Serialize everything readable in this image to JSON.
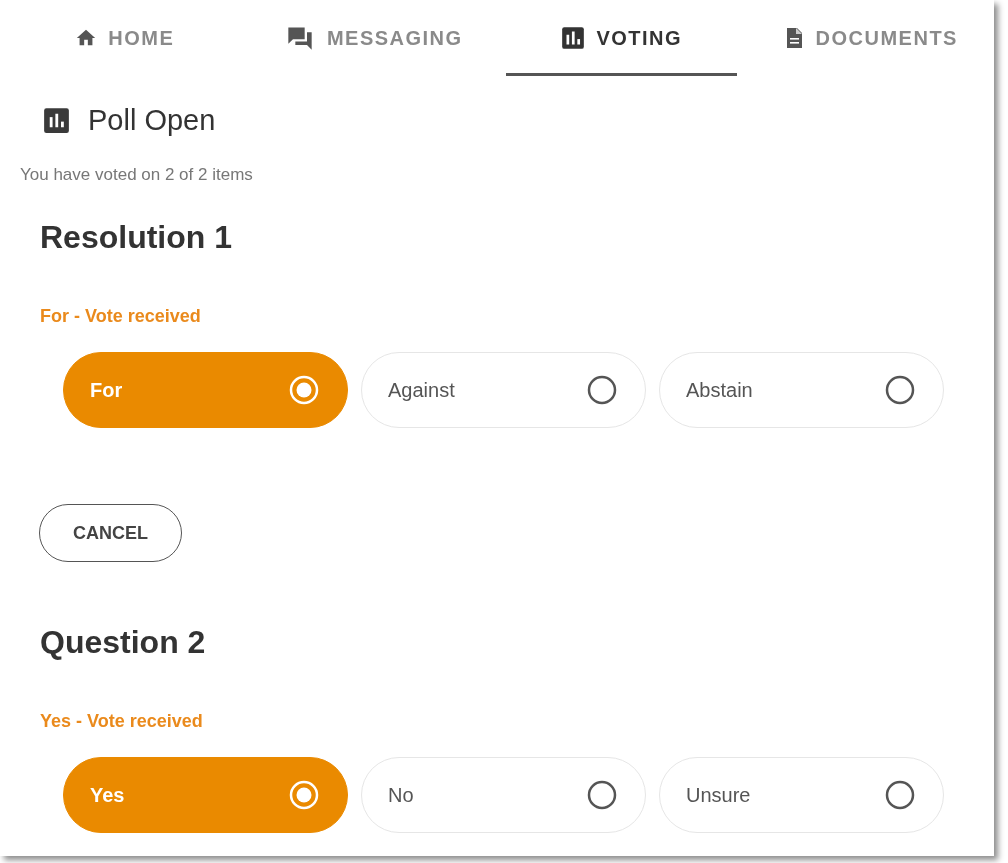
{
  "tabs": [
    {
      "label": "HOME",
      "selected": false
    },
    {
      "label": "MESSAGING",
      "selected": false
    },
    {
      "label": "VOTING",
      "selected": true
    },
    {
      "label": "DOCUMENTS",
      "selected": false
    }
  ],
  "poll": {
    "title": "Poll Open",
    "progress": "You have voted on 2 of 2 items"
  },
  "items": [
    {
      "title": "Resolution 1",
      "status": "For - Vote received",
      "options": [
        {
          "label": "For",
          "selected": true
        },
        {
          "label": "Against",
          "selected": false
        },
        {
          "label": "Abstain",
          "selected": false
        }
      ],
      "cancel_button": "CANCEL"
    },
    {
      "title": "Question 2",
      "status": "Yes - Vote received",
      "options": [
        {
          "label": "Yes",
          "selected": true
        },
        {
          "label": "No",
          "selected": false
        },
        {
          "label": "Unsure",
          "selected": false
        }
      ]
    }
  ]
}
